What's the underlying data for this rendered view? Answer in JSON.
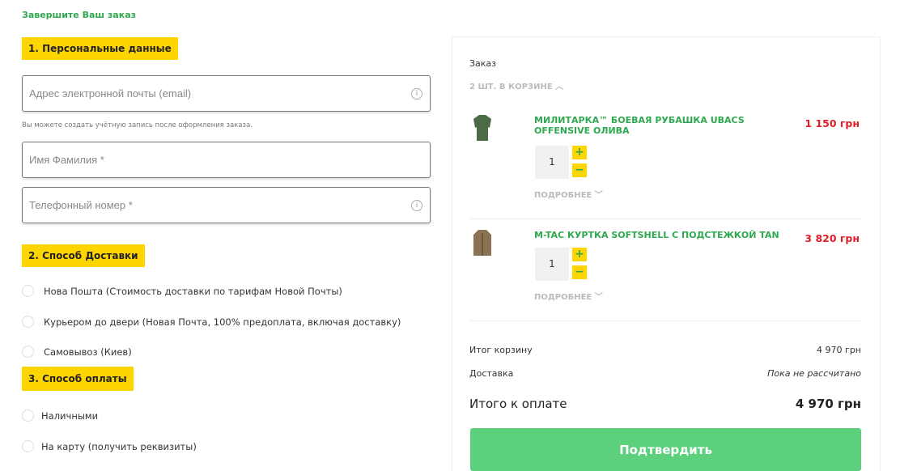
{
  "page": {
    "heading": "Завершите Ваш заказ"
  },
  "personal": {
    "section_title": "1. Персональные данные",
    "email_placeholder": "Адрес электронной почты (email)",
    "account_hint": "Вы можете создать учётную запись после оформления заказа.",
    "name_placeholder": "Имя Фамилия *",
    "phone_placeholder": "Телефонный номер *"
  },
  "delivery": {
    "section_title": "2. Способ Доставки",
    "options": [
      "Нова Пошта (Стоимость доставки по тарифам Новой Почты)",
      "Курьером до двери (Новая Почта, 100% предоплата, включая доставку)",
      "Самовывоз (Киев)"
    ]
  },
  "payment": {
    "section_title": "3. Способ оплаты",
    "options": [
      "Наличными",
      "На карту (получить реквизиты)"
    ]
  },
  "order": {
    "title": "Заказ",
    "cart_toggle": "2 ШТ. В КОРЗИНЕ",
    "items": [
      {
        "name": "МИЛИТАРКА™ БОЕВАЯ РУБАШКА UBACS OFFENSIVE ОЛИВА",
        "price": "1 150 грн",
        "quantity": "1",
        "more": "ПОДРОБНЕЕ",
        "image_color": "#4d6a47"
      },
      {
        "name": "M-TAC КУРТКА SOFTSHELL С ПОДСТЕЖКОЙ TAN",
        "price": "3 820 грн",
        "quantity": "1",
        "more": "ПОДРОБНЕЕ",
        "image_color": "#8a7254"
      }
    ],
    "subtotal_label": "Итог корзину",
    "subtotal_value": "4 970 грн",
    "shipping_label": "Доставка",
    "shipping_value": "Пока не рассчитано",
    "total_label": "Итого к оплате",
    "total_value": "4 970 грн",
    "confirm_label": "Подтвердить"
  },
  "colors": {
    "accent": "#2fa84f",
    "badge": "#ffd500",
    "price": "#e01f2a",
    "confirm": "#5cd07d"
  }
}
